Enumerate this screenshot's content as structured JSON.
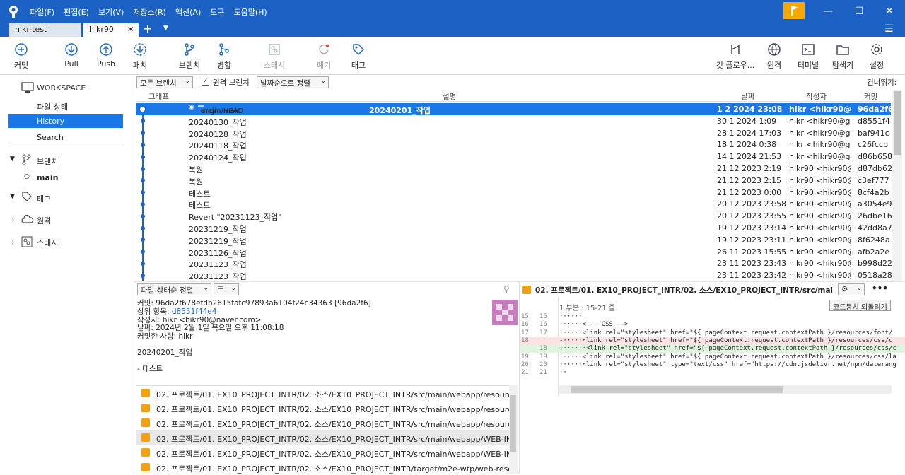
{
  "app": {
    "menus": [
      "파일(F)",
      "편집(E)",
      "보기(V)",
      "저장소(R)",
      "액션(A)",
      "도구",
      "도움말(H)"
    ]
  },
  "tabs": [
    "hikr-test",
    "hikr90"
  ],
  "toolbar": {
    "commit": "커밋",
    "pull": "Pull",
    "push": "Push",
    "fetch": "패치",
    "branch": "브랜치",
    "merge": "병합",
    "stash": "스태시",
    "discard": "폐기",
    "tag": "태그",
    "gitflow": "깃 플로우...",
    "remote": "원격",
    "terminal": "터미널",
    "explorer": "탐색기",
    "settings": "설정"
  },
  "sidebar": {
    "workspace": "WORKSPACE",
    "file_status": "파일 상태",
    "history": "History",
    "search": "Search",
    "branches": "브랜치",
    "main": "main",
    "tags": "태그",
    "remotes": "원격",
    "stashes": "스태시"
  },
  "filter": {
    "branches": "모든 브랜치",
    "remote_branches": "원격 브랜치",
    "sort": "날짜순으로 정렬",
    "jump": "건너뛰기:"
  },
  "columns": {
    "graph": "그래프",
    "desc": "설명",
    "date": "날짜",
    "author": "작성자",
    "commit": "커밋"
  },
  "refs": [
    "main",
    "origin/main",
    "origin/HEAD"
  ],
  "commits": [
    {
      "desc": "20240201_작업",
      "date": "1 2 2024 23:08",
      "author": "hikr <hikr90@nav",
      "hash": "96da2f6"
    },
    {
      "desc": "20240130_작업",
      "date": "30 1 2024 1:09",
      "author": "hikr <hikr90@gma",
      "hash": "d8551f4"
    },
    {
      "desc": "20240128_작업",
      "date": "28 1 2024 17:03",
      "author": "hikr <hikr90@gma",
      "hash": "baf941c"
    },
    {
      "desc": "20240118_작업",
      "date": "18 1 2024 0:38",
      "author": "hikr <hikr90@gma",
      "hash": "c26fccb"
    },
    {
      "desc": "20240124_작업",
      "date": "14 1 2024 21:53",
      "author": "hikr <hikr90@gma",
      "hash": "d86b658"
    },
    {
      "desc": "복원",
      "date": "21 12 2023 2:19",
      "author": "hikr90 <hikr90@n",
      "hash": "d87db62"
    },
    {
      "desc": "복원",
      "date": "21 12 2023 2:15",
      "author": "hikr90 <hikr90@n",
      "hash": "c3ef777"
    },
    {
      "desc": "테스트",
      "date": "21 12 2023 0:00",
      "author": "hikr90 <hikr90@n",
      "hash": "8cf4a2b"
    },
    {
      "desc": "테스트",
      "date": "20 12 2023 23:58",
      "author": "hikr90 <hikr90@n",
      "hash": "a3054e9"
    },
    {
      "desc": "Revert \"20231123_작업\"",
      "date": "20 12 2023 23:55",
      "author": "hikr90 <hikr90@n",
      "hash": "26dbe16"
    },
    {
      "desc": "20231219_작업",
      "date": "19 12 2023 23:14",
      "author": "hikr90 <hikr90@n",
      "hash": "42dd8a7"
    },
    {
      "desc": "20231219_작업",
      "date": "19 12 2023 23:11",
      "author": "hikr90 <hikr90@n",
      "hash": "8f6248a"
    },
    {
      "desc": "20231126_작업",
      "date": "26 11 2023 15:55",
      "author": "hikr90 <hikr90@n",
      "hash": "afb2a2e"
    },
    {
      "desc": "20231123_작업",
      "date": "23 11 2023 23:43",
      "author": "hikr90 <hikr90@n",
      "hash": "b998d22"
    },
    {
      "desc": "20231123_작업",
      "date": "23 11 2023 23:42",
      "author": "hikr90 <hikr90@n",
      "hash": "0518a28"
    }
  ],
  "bottom": {
    "sort": "파일 상태순 정렬",
    "commit_line": "커밋: 96da2f678efdb2615fafc97893a6104f24c34363 [96da2f6]",
    "parent_label": "상위 항목: ",
    "parent": "d8551f44e4",
    "author": "작성자: hikr <hikr90@naver.com>",
    "date": "날짜: 2024년 2월 1일 목요일 오후 11:08:18",
    "committer": "커밋한 사람: hikr",
    "message": "20240201_작업",
    "body": "- 테스트"
  },
  "files": [
    "02. 프로젝트/01. EX10_PROJECT_INTR/02. 소스/EX10_PROJECT_INTR/src/main/webapp/resources/css/...",
    "02. 프로젝트/01. EX10_PROJECT_INTR/02. 소스/EX10_PROJECT_INTR/src/main/webapp/resources/css/...",
    "02. 프로젝트/01. EX10_PROJECT_INTR/02. 소스/EX10_PROJECT_INTR/src/main/webapp/resources/font...",
    "02. 프로젝트/01. EX10_PROJECT_INTR/02. 소스/EX10_PROJECT_INTR/src/main/webapp/WEB-INF/view...",
    "02. 프로젝트/01. EX10_PROJECT_INTR/02. 소스/EX10_PROJECT_INTR/src/main/webapp/WEB-INF/view...",
    "02. 프로젝트/01. EX10_PROJECT_INTR/02. 소스/EX10_PROJECT_INTR/target/m2e-wtp/web-resources/..."
  ],
  "diff": {
    "path": "02. 프로젝트/01. EX10_PROJECT_INTR/02. 소스/EX10_PROJECT_INTR/src/main/webapp/WE...",
    "hunk": "1 부분 : 15-21 줄",
    "revert": "코드뭉치 되돌리기",
    "lines": [
      {
        "o": "15",
        "n": "15",
        "t": "······"
      },
      {
        "o": "16",
        "n": "16",
        "t": "······<!-- CSS -->"
      },
      {
        "o": "17",
        "n": "17",
        "t": "······<link rel=\"stylesheet\" href=\"${ pageContext.request.contextPath }/resources/font/"
      },
      {
        "o": "18",
        "n": "",
        "t": "-·····<link rel=\"stylesheet\" href=\"${ pageContext.request.contextPath }/resources/css/c"
      },
      {
        "o": "",
        "n": "18",
        "t": "+······<link rel=\"stylesheet\" href=\"${ pageContext.request.contextPath }/resources/css/c"
      },
      {
        "o": "19",
        "n": "19",
        "t": "······<link rel=\"stylesheet\" href=\"${ pageContext.request.contextPath }/resources/css/la"
      },
      {
        "o": "20",
        "n": "20",
        "t": "······<link rel=\"stylesheet\" type=\"text/css\" href=\"https://cdn.jsdelivr.net/npm/daterang"
      },
      {
        "o": "21",
        "n": "21",
        "t": "··"
      }
    ]
  }
}
